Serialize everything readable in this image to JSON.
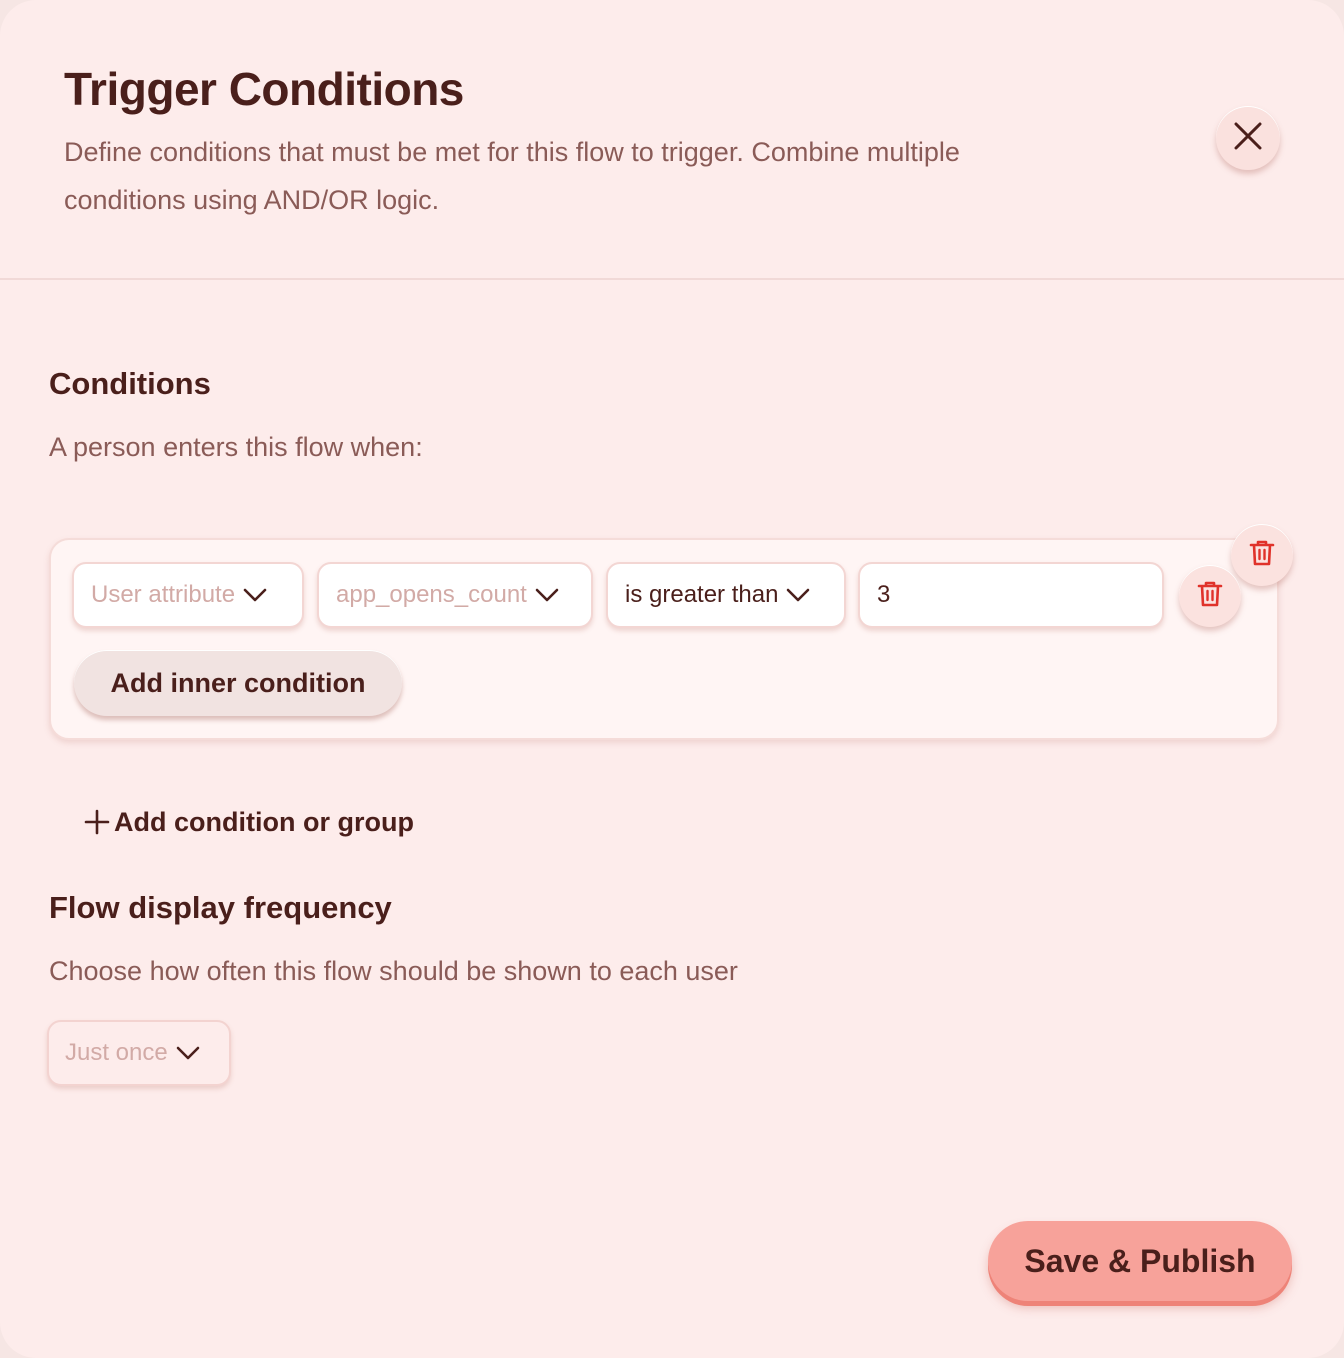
{
  "header": {
    "title": "Trigger Conditions",
    "description": "Define conditions that must be met for this flow to trigger. Combine multiple conditions using AND/OR logic.",
    "close_icon": "close-icon"
  },
  "conditions": {
    "title": "Conditions",
    "subtitle": "A person enters this flow when:",
    "group": {
      "attribute_type": "User attribute",
      "attribute_name": "app_opens_count",
      "operator": "is greater than",
      "value": "3",
      "add_inner_label": "Add inner condition"
    },
    "add_condition_label": "Add condition or group"
  },
  "frequency": {
    "title": "Flow display frequency",
    "subtitle": "Choose how often this flow should be shown to each user",
    "selected": "Just once"
  },
  "footer": {
    "save_label": "Save & Publish"
  },
  "colors": {
    "accent": "#f7a29a",
    "danger": "#e0322a",
    "text": "#4a1f1b"
  }
}
